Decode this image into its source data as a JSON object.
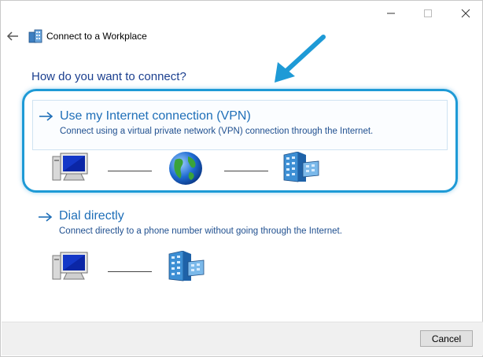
{
  "window": {
    "title": "Connect to a Workplace",
    "controls": [
      "minimize",
      "maximize",
      "close"
    ]
  },
  "heading": "How do you want to connect?",
  "options": [
    {
      "title": "Use my Internet connection (VPN)",
      "description": "Connect using a virtual private network (VPN) connection through the Internet.",
      "diagram": [
        "computer-icon",
        "globe-icon",
        "building-icon"
      ],
      "highlighted": true
    },
    {
      "title": "Dial directly",
      "description": "Connect directly to a phone number without going through the Internet.",
      "diagram": [
        "computer-icon",
        "building-icon"
      ],
      "highlighted": false
    }
  ],
  "footer": {
    "cancel_label": "Cancel"
  },
  "colors": {
    "heading": "#1b3f8f",
    "link": "#1f6fb8",
    "highlight": "#1e9ad6"
  }
}
